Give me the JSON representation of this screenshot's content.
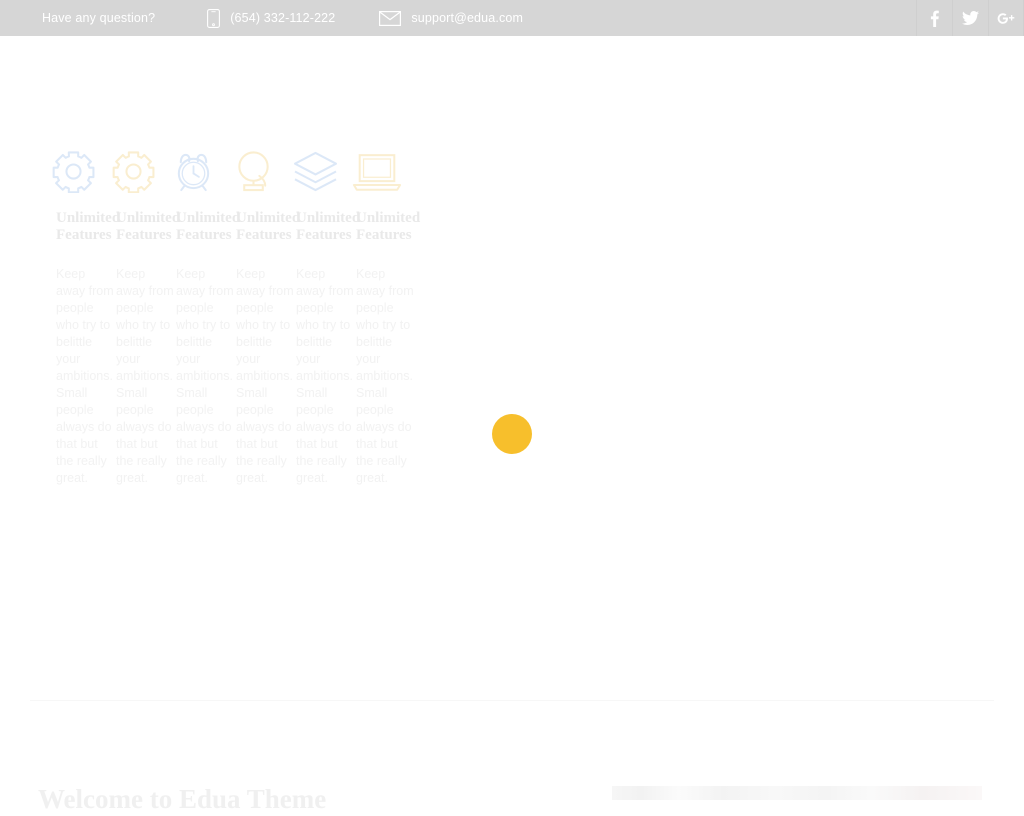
{
  "topbar": {
    "question_label": "Have any question?",
    "phone": "(654) 332-112-222",
    "email": "support@edua.com",
    "phone_icon": "mobile-phone-icon",
    "email_icon": "envelope-icon",
    "background_color": "#d6d6d6",
    "text_color": "#ffffff",
    "social": [
      {
        "name": "facebook",
        "label": "f"
      },
      {
        "name": "twitter",
        "label": ""
      },
      {
        "name": "google-plus",
        "label": "g+"
      }
    ]
  },
  "features": {
    "items": [
      {
        "icon": "gear-icon",
        "icon_color": "#dbe6f5",
        "title": "Unlimited Features",
        "body": "Keep away from people who try to belittle your ambitions. Small people always do that but the really great."
      },
      {
        "icon": "gear-icon",
        "icon_color": "#f8e6bd",
        "title": "Unlimited Features",
        "body": "Keep away from people who try to belittle your ambitions. Small people always do that but the really great."
      },
      {
        "icon": "alarm-clock-icon",
        "icon_color": "#dbe6f5",
        "title": "Unlimited Features",
        "body": "Keep away from people who try to belittle your ambitions. Small people always do that but the really great."
      },
      {
        "icon": "globe-stand-icon",
        "icon_color": "#f8e6bd",
        "title": "Unlimited Features",
        "body": "Keep away from people who try to belittle your ambitions. Small people always do that but the really great."
      },
      {
        "icon": "layers-icon",
        "icon_color": "#dbe6f5",
        "title": "Unlimited Features",
        "body": "Keep away from people who try to belittle your ambitions. Small people always do that but the really great."
      },
      {
        "icon": "laptop-icon",
        "icon_color": "#f8e6bd",
        "title": "Unlimited Features",
        "body": "Keep away from people who try to belittle your ambitions. Small people always do that but the really great."
      }
    ]
  },
  "loading": {
    "spinner_name": "loading-spinner",
    "spinner_color": "#f7bf2c"
  },
  "welcome": {
    "heading": "Welcome to Edua Theme"
  }
}
